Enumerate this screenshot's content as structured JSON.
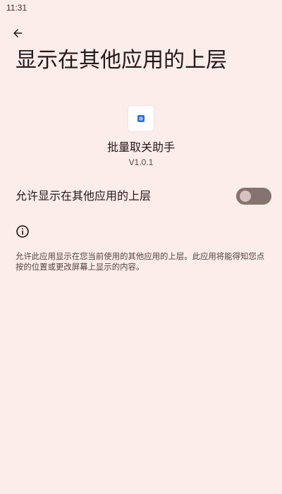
{
  "status_bar": {
    "time": "11:31"
  },
  "header": {
    "title": "显示在其他应用的上层"
  },
  "app": {
    "name": "批量取关助手",
    "version": "V1.0.1",
    "icon": "app-icon"
  },
  "setting": {
    "label": "允许显示在其他应用的上层",
    "enabled": false
  },
  "info": {
    "icon": "info-icon",
    "description": "允许此应用显示在您当前使用的其他应用的上层。此应用将能得知您点按的位置或更改屏幕上显示的内容。"
  },
  "colors": {
    "background": "#fcecea",
    "toggle_track": "#857370",
    "toggle_thumb": "#d8c2bf",
    "app_icon_accent": "#2f6fdc"
  }
}
